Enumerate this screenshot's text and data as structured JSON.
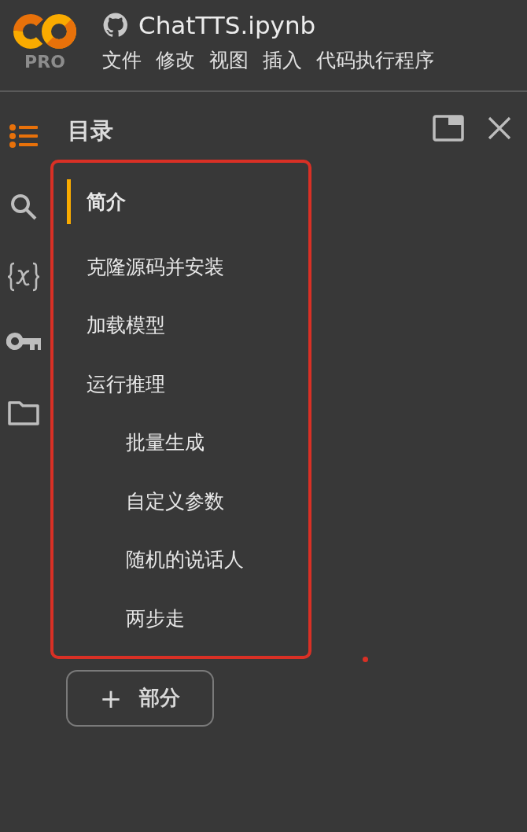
{
  "logo": {
    "badge": "PRO"
  },
  "notebook": {
    "title": "ChatTTS.ipynb"
  },
  "menu": [
    "文件",
    "修改",
    "视图",
    "插入",
    "代码执行程序"
  ],
  "side_tools": [
    {
      "kind": "toc",
      "selected": true
    },
    {
      "kind": "search",
      "selected": false
    },
    {
      "kind": "variables",
      "selected": false
    },
    {
      "kind": "secrets",
      "selected": false
    },
    {
      "kind": "files",
      "selected": false
    }
  ],
  "panel": {
    "title": "目录",
    "toc": [
      {
        "label": "简介",
        "selected": true
      },
      {
        "label": "克隆源码并安装",
        "selected": false
      },
      {
        "label": "加载模型",
        "selected": false
      },
      {
        "label": "运行推理",
        "selected": false,
        "children": [
          {
            "label": "批量生成",
            "selected": false
          },
          {
            "label": "自定义参数",
            "selected": false
          },
          {
            "label": "随机的说话人",
            "selected": false
          },
          {
            "label": "两步走",
            "selected": false
          }
        ]
      }
    ],
    "add_button": {
      "icon": "+",
      "label": "部分"
    }
  }
}
